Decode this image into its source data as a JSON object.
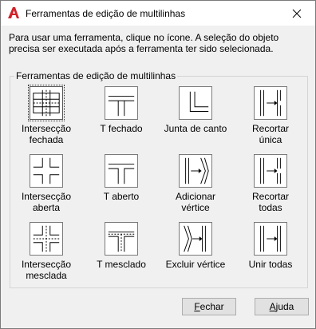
{
  "window": {
    "title": "Ferramentas de edição de multilinhas",
    "app_icon": "autocad-a-icon",
    "close_icon": "close-icon"
  },
  "instructions": "Para usar uma ferramenta, clique no ícone. A seleção do objeto precisa ser executada após a ferramenta ter sido selecionada.",
  "group": {
    "label": "Ferramentas de edição de multilinhas"
  },
  "tools": [
    {
      "label": "Intersecção\nfechada",
      "icon": "closed-cross-icon",
      "selected": true
    },
    {
      "label": "T fechado",
      "icon": "closed-tee-icon"
    },
    {
      "label": "Junta de canto",
      "icon": "corner-joint-icon"
    },
    {
      "label": "Recortar\núnica",
      "icon": "cut-single-icon"
    },
    {
      "label": "Intersecção\naberta",
      "icon": "open-cross-icon"
    },
    {
      "label": "T aberto",
      "icon": "open-tee-icon"
    },
    {
      "label": "Adicionar\nvértice",
      "icon": "add-vertex-icon"
    },
    {
      "label": "Recortar\ntodas",
      "icon": "cut-all-icon"
    },
    {
      "label": "Intersecção\nmesclada",
      "icon": "merged-cross-icon"
    },
    {
      "label": "T mesclado",
      "icon": "merged-tee-icon"
    },
    {
      "label": "Excluir vértice",
      "icon": "delete-vertex-icon"
    },
    {
      "label": "Unir todas",
      "icon": "weld-all-icon"
    }
  ],
  "buttons": {
    "close_mnemonic": "F",
    "close_rest": "echar",
    "help_mnemonic": "A",
    "help_rest": "juda"
  }
}
